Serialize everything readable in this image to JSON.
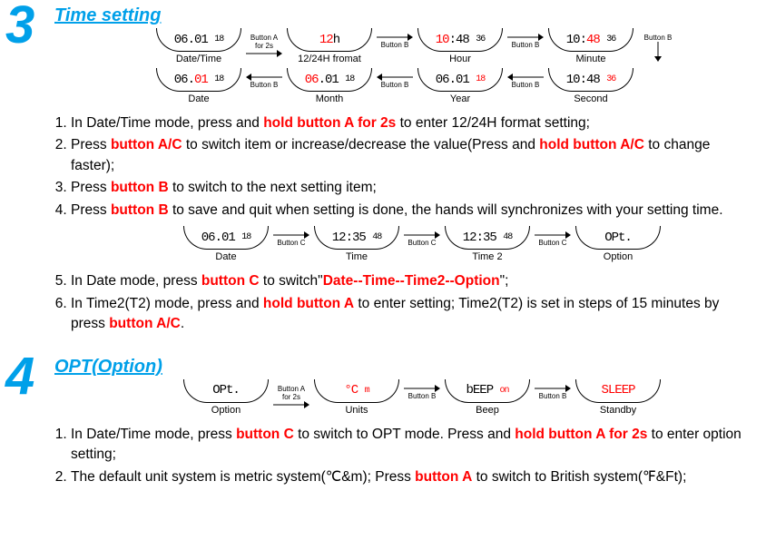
{
  "s3": {
    "num": "3",
    "heading": "Time setting",
    "row1": {
      "d1": {
        "p1": "06.01",
        "p2": "18",
        "lbl": "Date/Time"
      },
      "a1": {
        "t1": "Button A",
        "t2": "for 2s"
      },
      "d2": {
        "p1": "12",
        "p2": "h",
        "lbl": "12/24H fromat"
      },
      "a2": {
        "t1": "Button B"
      },
      "d3": {
        "p1": "10",
        "p2": ":48",
        "p3": "36",
        "lbl": "Hour"
      },
      "a3": {
        "t1": "Button B"
      },
      "d4": {
        "p1": "10:",
        "p2": "48",
        "p3": "36",
        "lbl": "Minute"
      },
      "a4": {
        "t1": "Button B"
      }
    },
    "row2": {
      "d5": {
        "p1": "06.",
        "p2": "01",
        "p3": "18",
        "lbl": "Date"
      },
      "a5": {
        "t1": "Button B"
      },
      "d6": {
        "p1": "06",
        "p2": ".01",
        "p3": "18",
        "lbl": "Month"
      },
      "a6": {
        "t1": "Button B"
      },
      "d7": {
        "p1": "06.01",
        "p2": "18",
        "lbl": "Year"
      },
      "a7": {
        "t1": "Button B"
      },
      "d8": {
        "p1": "10:48",
        "p2": "36",
        "lbl": "Second"
      }
    },
    "list1": {
      "i1a": "In Date/Time mode, press and ",
      "i1b": "hold button A for 2s",
      "i1c": " to enter 12/24H format setting;",
      "i2a": "Press ",
      "i2b": "button A/C",
      "i2c": " to switch item or increase/decrease the value(Press and ",
      "i2d": "hold button A/C",
      "i2e": " to change faster);",
      "i3a": "Press ",
      "i3b": "button B",
      "i3c": " to switch to the next setting item;",
      "i4a": "Press ",
      "i4b": "button B",
      "i4c": " to save and quit when setting is done, the hands will synchronizes with your setting time."
    },
    "row3": {
      "d1": {
        "p1": "06.01",
        "p2": "18",
        "lbl": "Date"
      },
      "a1": {
        "t1": "Button C"
      },
      "d2": {
        "p1": "12:35",
        "p2": "48",
        "lbl": "Time"
      },
      "a2": {
        "t1": "Button C"
      },
      "d3": {
        "p1": "12:35",
        "p2": "48",
        "lbl": "Time 2"
      },
      "a3": {
        "t1": "Button C"
      },
      "d4": {
        "p1": "OPt.",
        "lbl": "Option"
      }
    },
    "list2": {
      "i5a": "In Date mode, press ",
      "i5b": "button C",
      "i5c": " to switch\"",
      "i5d": "Date--Time--Time2--Option",
      "i5e": "\";",
      "i6a": "In Time2(T2) mode, press and ",
      "i6b": "hold button A",
      "i6c": " to enter setting; Time2(T2) is set in steps of 15 minutes by press ",
      "i6d": "button A/C",
      "i6e": "."
    }
  },
  "s4": {
    "num": "4",
    "heading": "OPT(Option)",
    "row1": {
      "d1": {
        "p1": "OPt.",
        "lbl": "Option"
      },
      "a1": {
        "t1": "Button A",
        "t2": "for 2s"
      },
      "d2": {
        "p1": "°C",
        "p2": "m",
        "lbl": "Units"
      },
      "a2": {
        "t1": "Button B"
      },
      "d3": {
        "p1": "bEEP",
        "p2": "on",
        "lbl": "Beep"
      },
      "a3": {
        "t1": "Button B"
      },
      "d4": {
        "p1": "SLEEP",
        "lbl": "Standby"
      }
    },
    "list": {
      "i1a": "In Date/Time mode, press ",
      "i1b": "button C",
      "i1c": " to switch to OPT mode. Press and ",
      "i1d": "hold button A for 2s",
      "i1e": " to enter option setting;",
      "i2a": "The default unit system is metric system(℃&m); Press ",
      "i2b": "button A",
      "i2c": " to switch to British system(℉&Ft);"
    }
  }
}
